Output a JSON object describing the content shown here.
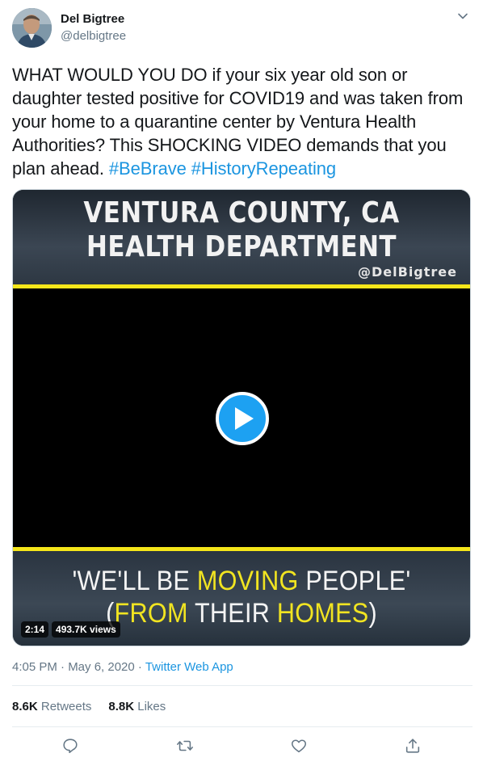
{
  "author": {
    "name": "Del Bigtree",
    "handle": "@delbigtree"
  },
  "tweet": {
    "text": "WHAT WOULD YOU DO if your six year old son or daughter tested positive for COVID19 and was taken from your home to a quarantine center by Ventura Health Authorities?  This SHOCKING VIDEO demands that you plan ahead.",
    "hashtags": [
      "#BeBrave",
      "#HistoryRepeating"
    ]
  },
  "video": {
    "title_line1": "VENTURA COUNTY, CA",
    "title_line2": "HEALTH DEPARTMENT",
    "credit": "@DelBigtree",
    "quote_open": "'WE'LL BE ",
    "quote_hl1": "MOVING",
    "quote_mid": " PEOPLE'",
    "quote2_open": "(",
    "quote2_hl1": "FROM",
    "quote2_mid": " THEIR ",
    "quote2_hl2": "HOMES",
    "quote2_close": ")",
    "duration": "2:14",
    "views": "493.7K views"
  },
  "meta": {
    "time": "4:05 PM · May 6, 2020 · ",
    "app": "Twitter Web App"
  },
  "stats": {
    "retweets_count": "8.6K",
    "retweets_label": "Retweets",
    "likes_count": "8.8K",
    "likes_label": "Likes"
  },
  "icons": {
    "reply": "reply-icon",
    "retweet": "retweet-icon",
    "like": "heart-icon",
    "share": "share-icon",
    "more": "chevron-down-icon"
  },
  "colors": {
    "link": "#1b95e0",
    "play": "#1da1f2",
    "highlight": "#f1e421"
  }
}
